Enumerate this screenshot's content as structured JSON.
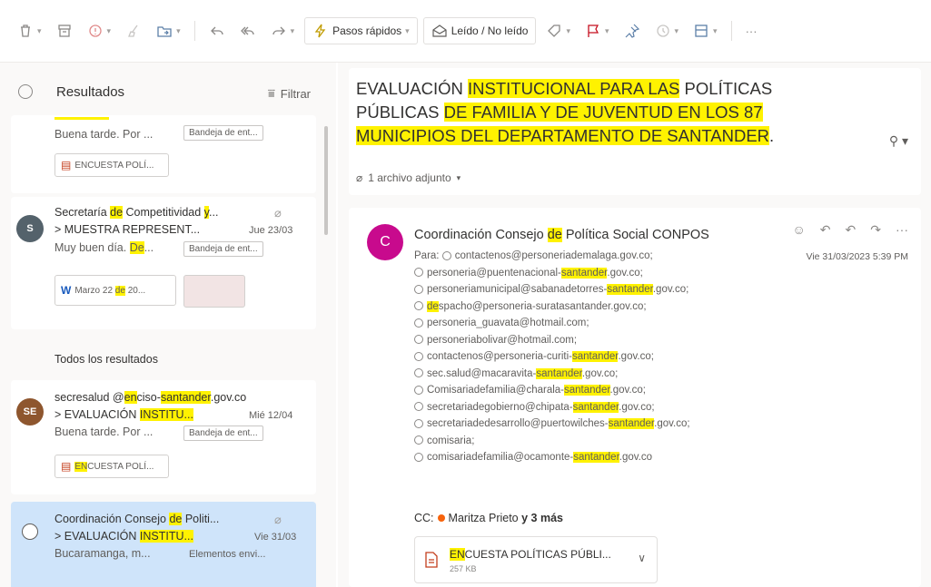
{
  "toolbar": {
    "quick_steps": "Pasos rápidos",
    "read_unread": "Leído / No leído",
    "more": "···"
  },
  "list": {
    "title": "Resultados",
    "filter": "Filtrar",
    "item1": {
      "preview": "Buena tarde. Por ...",
      "folder": "Bandeja de ent...",
      "attachment": "ENCUESTA POLÍ..."
    },
    "item2": {
      "avatar": "S",
      "sender": "Secretaría de Competitividad y...",
      "subject": "> MUESTRA REPRESENT...",
      "date": "Jue 23/03",
      "preview": "Muy buen día. De...",
      "folder": "Bandeja de ent...",
      "attachment": "Marzo 22 de 20..."
    },
    "all_results": "Todos los resultados",
    "item3": {
      "avatar": "SE",
      "sender": "secresalud @enciso-santander.gov.co",
      "subject": "> EVALUACIÓN INSTITU...",
      "date": "Mié 12/04",
      "preview": "Buena tarde. Por ...",
      "folder": "Bandeja de ent...",
      "attachment": "ENCUESTA POLÍ..."
    },
    "item4": {
      "sender": "Coordinación Consejo de Políti...",
      "subject": "> EVALUACIÓN INSTITU...",
      "date": "Vie 31/03",
      "preview": "Bucaramanga, m...",
      "folder": "Elementos envi..."
    }
  },
  "reading": {
    "subject": "EVALUACIÓN INSTITUCIONAL PARA LAS POLÍTICAS PÚBLICAS DE FAMILIA Y DE JUVENTUD EN LOS 87 MUNICIPIOS DEL DEPARTAMENTO DE SANTANDER.",
    "attach_count": "1 archivo adjunto",
    "message": {
      "avatar": "C",
      "sender": "Coordinación Consejo de Política Social CONPOS",
      "date": "Vie 31/03/2023 5:39 PM",
      "to_label": "Para:",
      "recipients": [
        "contactenos@personeriademalaga.gov.co;",
        "personeria@puentenacional-santander.gov.co;",
        "personeriamunicipal@sabanadetorres-santander.gov.co;",
        "despacho@personeria-suratasantander.gov.co;",
        "personeria_guavata@hotmail.com;",
        "personeriabolivar@hotmail.com;",
        "contactenos@personeria-curiti-santander.gov.co;",
        "sec.salud@macaravita-santander.gov.co;",
        "Comisariadefamilia@charala-santander.gov.co;",
        "secretariadegobierno@chipata-santander.gov.co;",
        "secretariadedesarrollo@puertowilches-santander.gov.co;",
        "comisaria;",
        "comisariadefamilia@ocamonte-santander.gov.co"
      ],
      "cc_label": "CC:",
      "cc_name": "Maritza Prieto",
      "cc_more": "y 3 más",
      "file_name": "ENCUESTA POLÍTICAS PÚBLI...",
      "file_size": "257 KB"
    }
  },
  "colors": {
    "highlight": "#fff200",
    "selected": "#cfe4fa",
    "avatar_s": "#54626b",
    "avatar_se": "#8e562e",
    "avatar_c": "#c80a8d"
  }
}
